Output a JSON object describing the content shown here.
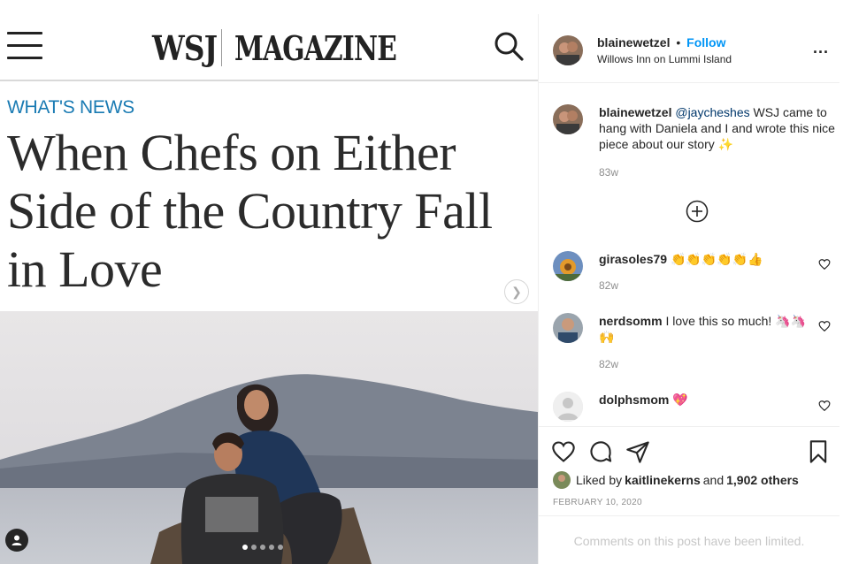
{
  "article": {
    "logo_left": "WSJ",
    "logo_right": "MAGAZINE",
    "kicker": "WHAT'S NEWS",
    "headline": "When Chefs on Either Side of the Country Fall in Love",
    "carousel_count": 5,
    "carousel_active": 1
  },
  "post": {
    "username": "blainewetzel",
    "follow_label": "Follow",
    "separator": "•",
    "location": "Willows Inn on Lummi Island",
    "more_label": "...",
    "caption": {
      "username": "blainewetzel",
      "mention": "@jaycheshes",
      "text": " WSJ came to hang with Daniela and I and wrote this nice piece about our story ✨",
      "time": "83w"
    },
    "comments": [
      {
        "username": "girasoles79",
        "text": " 👏👏👏👏👏👍",
        "time": "82w"
      },
      {
        "username": "nerdsomm",
        "text": " I love this so much! 🦄🦄🙌",
        "time": "82w"
      },
      {
        "username": "dolphsmom",
        "text": " 💖",
        "time": ""
      }
    ],
    "liked_by_prefix": "Liked by ",
    "liked_by_user": "kaitlinekerns",
    "liked_by_and": " and ",
    "liked_by_others": "1,902 others",
    "date": "FEBRUARY 10, 2020",
    "comments_limited": "Comments on this post have been limited."
  },
  "colors": {
    "link_blue": "#0095f6",
    "kicker_blue": "#1a7bb3",
    "mention": "#00376b",
    "muted": "#8e8e8e"
  },
  "icons": [
    "menu-icon",
    "search-icon",
    "chevron-right-icon",
    "more-icon",
    "add-comment-icon",
    "heart-icon",
    "comment-icon",
    "share-icon",
    "bookmark-icon",
    "tag-user-icon"
  ]
}
